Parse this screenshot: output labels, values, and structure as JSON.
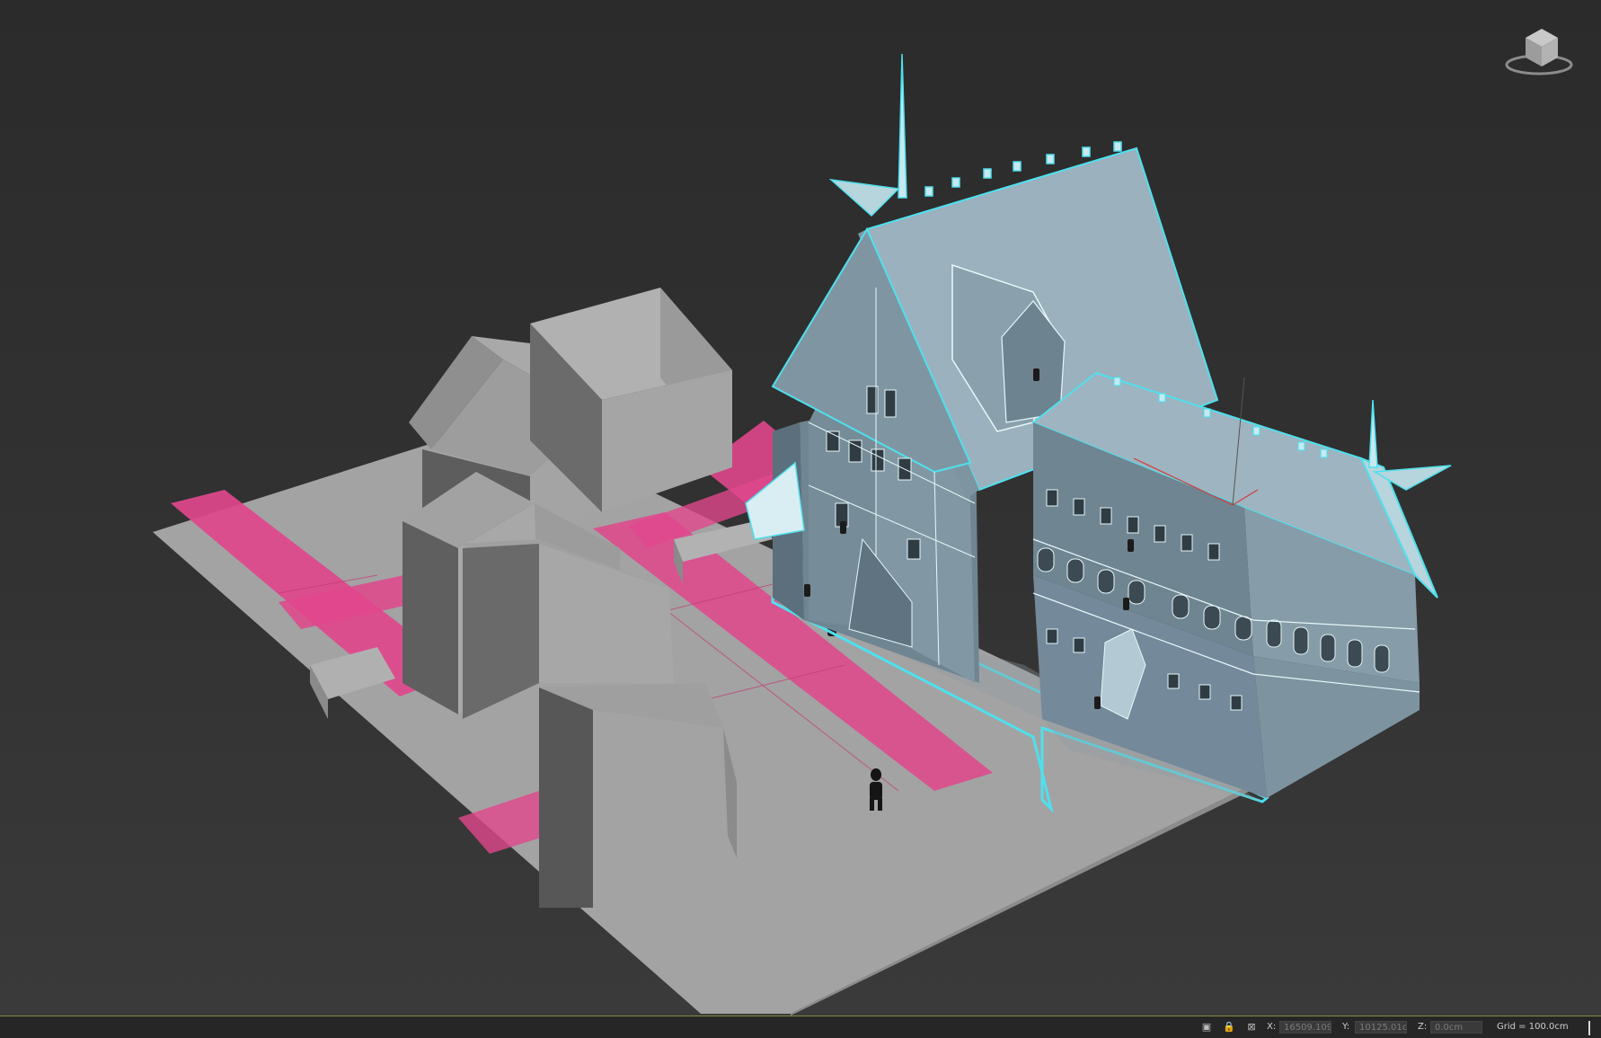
{
  "colors": {
    "background": "#2d2d2d",
    "ground": "#a3a3a3",
    "pink_strip": "#e0478c",
    "block_gray": "#a6a6a6",
    "building_body": "#7f95a1",
    "selection": "#4fe0ee"
  },
  "icons": {
    "viewcube": "viewcube-icon",
    "selection_lock_toggle": "selection-lock-icon",
    "lock": "lock-icon",
    "absolute_mode": "transform-mode-icon"
  },
  "statusbar": {
    "x_label": "X:",
    "x_value": "16509.109",
    "y_label": "Y:",
    "y_value": "10125.01c",
    "z_label": "Z:",
    "z_value": "0.0cm",
    "grid_text": "Grid = 100.0cm"
  }
}
